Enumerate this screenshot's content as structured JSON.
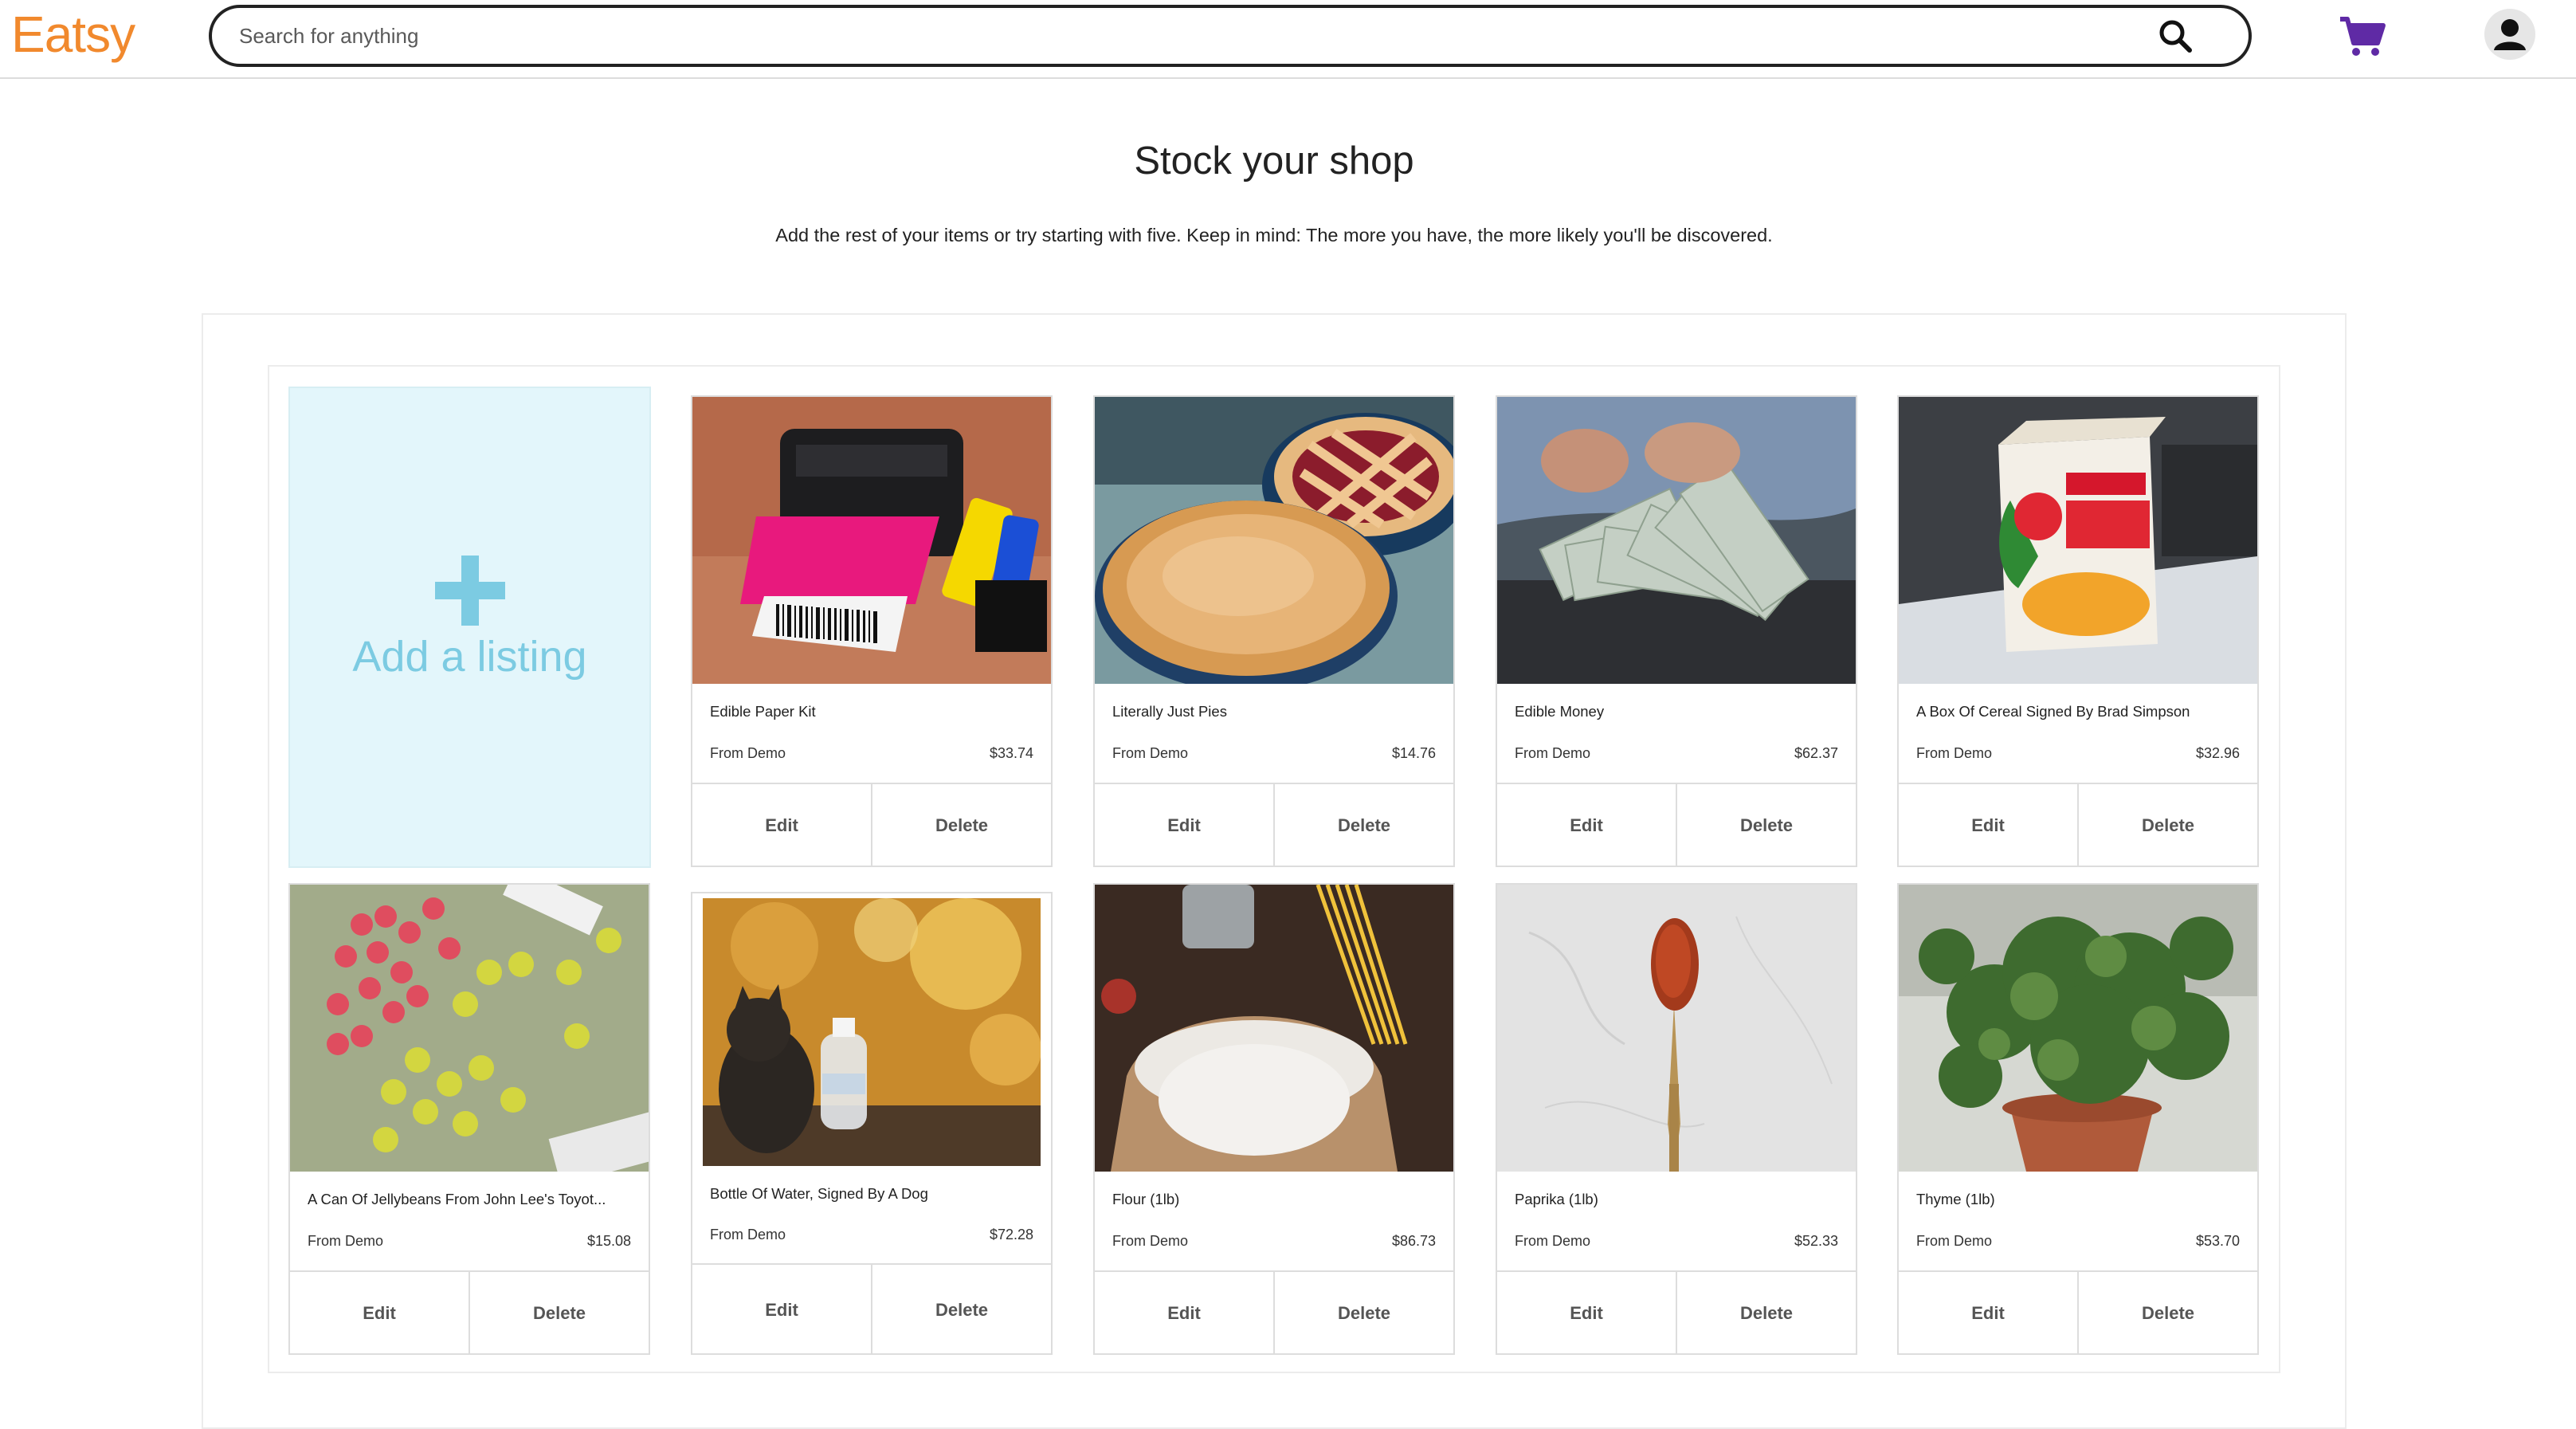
{
  "header": {
    "logo": "Eatsy",
    "search_placeholder": "Search for anything",
    "search_icon": "magnifier-icon",
    "cart_icon": "shopping-cart-icon",
    "avatar_icon": "user-avatar-icon"
  },
  "colors": {
    "brand": "#f1892d",
    "cart": "#5f2aa5",
    "add_listing_bg": "#e3f6fb",
    "add_listing_accent": "#7ccbe2"
  },
  "page": {
    "title": "Stock your shop",
    "subtitle": "Add the rest of your items or try starting with five. Keep in mind: The more you have, the more likely you'll be discovered."
  },
  "add_listing": {
    "label": "Add a listing",
    "icon": "plus-icon"
  },
  "products": [
    {
      "title": "Edible Paper Kit",
      "shop": "From Demo",
      "price": "$33.74",
      "edit": "Edit",
      "delete": "Delete",
      "image": "printer-photo"
    },
    {
      "title": "Literally Just Pies",
      "shop": "From Demo",
      "price": "$14.76",
      "edit": "Edit",
      "delete": "Delete",
      "image": "pie-photo"
    },
    {
      "title": "Edible Money",
      "shop": "From Demo",
      "price": "$62.37",
      "edit": "Edit",
      "delete": "Delete",
      "image": "money-photo"
    },
    {
      "title": "A Box Of Cereal Signed By Brad Simpson",
      "shop": "From Demo",
      "price": "$32.96",
      "edit": "Edit",
      "delete": "Delete",
      "image": "cereal-photo"
    },
    {
      "title": "A Can Of Jellybeans From John Lee's Toyot...",
      "shop": "From Demo",
      "price": "$15.08",
      "edit": "Edit",
      "delete": "Delete",
      "image": "jellybeans-photo"
    },
    {
      "title": "Bottle Of Water, Signed By A Dog",
      "shop": "From Demo",
      "price": "$72.28",
      "edit": "Edit",
      "delete": "Delete",
      "image": "water-bottle-photo"
    },
    {
      "title": "Flour (1lb)",
      "shop": "From Demo",
      "price": "$86.73",
      "edit": "Edit",
      "delete": "Delete",
      "image": "flour-photo"
    },
    {
      "title": "Paprika (1lb)",
      "shop": "From Demo",
      "price": "$52.33",
      "edit": "Edit",
      "delete": "Delete",
      "image": "paprika-photo"
    },
    {
      "title": "Thyme (1lb)",
      "shop": "From Demo",
      "price": "$53.70",
      "edit": "Edit",
      "delete": "Delete",
      "image": "thyme-photo"
    }
  ]
}
